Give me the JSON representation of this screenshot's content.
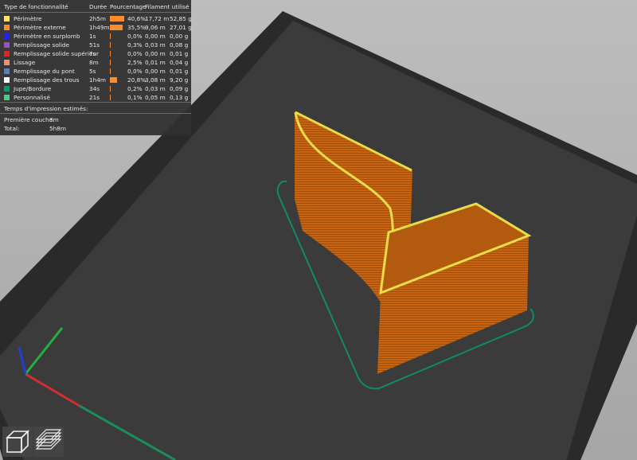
{
  "legend": {
    "headers": {
      "type": "Type de fonctionnalité",
      "duration": "Durée",
      "percent": "Pourcentage",
      "filament": "Filament utilisé"
    },
    "rows": [
      {
        "color": "#ffe65a",
        "label": "Périmètre",
        "duration": "2h5m",
        "percent": "40,6%",
        "fill": 0.406,
        "length": "17,72 m",
        "weight": "52,85 g"
      },
      {
        "color": "#ff8c2a",
        "label": "Périmètre externe",
        "duration": "1h49m",
        "percent": "35,5%",
        "fill": 0.355,
        "length": "9,06 m",
        "weight": "27,01 g"
      },
      {
        "color": "#2222ff",
        "label": "Périmètre en surplomb",
        "duration": "1s",
        "percent": "0,0%",
        "fill": 0.0,
        "length": "0,00 m",
        "weight": "0,00 g"
      },
      {
        "color": "#9a4fd4",
        "label": "Remplissage solide",
        "duration": "51s",
        "percent": "0,3%",
        "fill": 0.003,
        "length": "0,03 m",
        "weight": "0,08 g"
      },
      {
        "color": "#e02424",
        "label": "Remplissage solide supérieur",
        "duration": "7s",
        "percent": "0,0%",
        "fill": 0.0,
        "length": "0,00 m",
        "weight": "0,01 g"
      },
      {
        "color": "#ff8a6a",
        "label": "Lissage",
        "duration": "8m",
        "percent": "2,5%",
        "fill": 0.025,
        "length": "0,01 m",
        "weight": "0,04 g"
      },
      {
        "color": "#5a7fb8",
        "label": "Remplissage du pont",
        "duration": "5s",
        "percent": "0,0%",
        "fill": 0.0,
        "length": "0,00 m",
        "weight": "0,01 g"
      },
      {
        "color": "#ffffff",
        "label": "Remplissage des trous",
        "duration": "1h4m",
        "percent": "20,8%",
        "fill": 0.208,
        "length": "3,08 m",
        "weight": "9,20 g"
      },
      {
        "color": "#0b9a70",
        "label": "Jupe/Bordure",
        "duration": "34s",
        "percent": "0,2%",
        "fill": 0.002,
        "length": "0,03 m",
        "weight": "0,09 g"
      },
      {
        "color": "#3cd28a",
        "label": "Personnalisé",
        "duration": "21s",
        "percent": "0,1%",
        "fill": 0.001,
        "length": "0,05 m",
        "weight": "0,13 g"
      }
    ],
    "bar_color": "#ff8c2a",
    "estimates_title": "Temps d'impression estimés:",
    "first_layer_label": "Première couche:",
    "first_layer_value": "3m",
    "total_label": "Total:",
    "total_value": "5h8m"
  },
  "view_buttons": [
    {
      "name": "3d-view-button",
      "icon": "cube-icon"
    },
    {
      "name": "layers-view-button",
      "icon": "layers-icon"
    }
  ]
}
